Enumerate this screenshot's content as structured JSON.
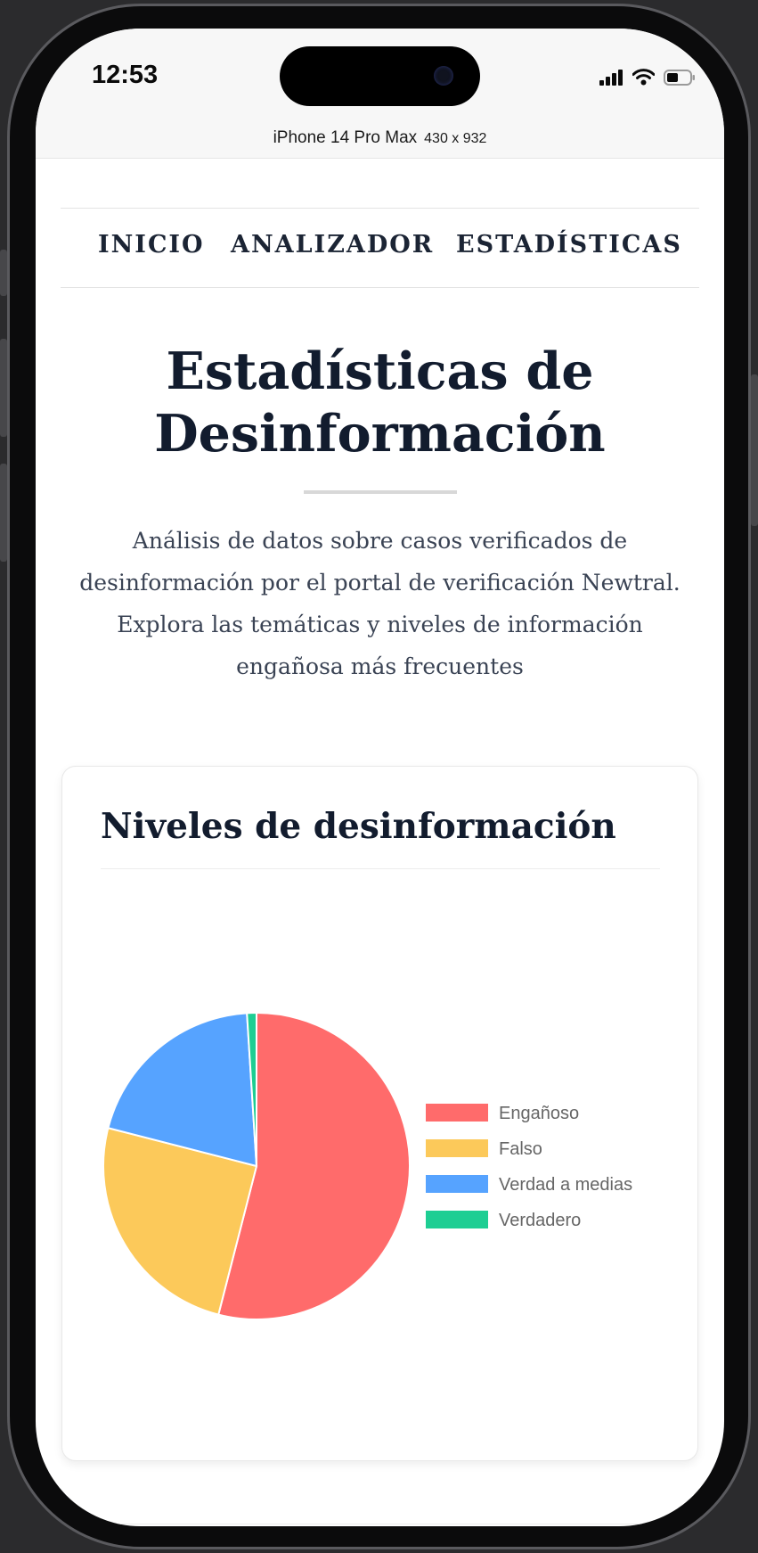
{
  "status_bar": {
    "time": "12:53",
    "device_name": "iPhone 14 Pro Max",
    "device_size": "430 x 932",
    "signal_icon": "cellular-signal-icon",
    "wifi_icon": "wifi-icon",
    "battery_icon": "battery-icon"
  },
  "nav": {
    "items": [
      {
        "label": "INICIO"
      },
      {
        "label": "ANALIZADOR"
      },
      {
        "label": "ESTADÍSTICAS"
      }
    ]
  },
  "header": {
    "title": "Estadísticas de Desinformación",
    "intro": "Análisis de datos sobre casos verificados de desinformación por el portal de verificación Newtral. Explora las temáticas y niveles de información engañosa más frecuentes"
  },
  "card": {
    "title": "Niveles de desinformación"
  },
  "chart_data": {
    "type": "pie",
    "categories": [
      "Engañoso",
      "Falso",
      "Verdad a medias",
      "Verdadero"
    ],
    "values": [
      54,
      25,
      20,
      1
    ],
    "colors": [
      "#ff6b6b",
      "#fcc95a",
      "#56a3ff",
      "#1ece93"
    ],
    "legend_position": "right"
  },
  "colors": {
    "heading": "#121c2e",
    "body_text": "#3a4354",
    "legend_text": "#666666"
  }
}
